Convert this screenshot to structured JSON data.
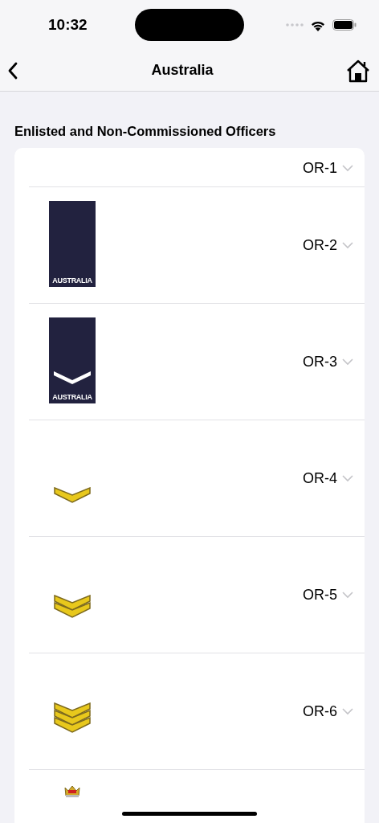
{
  "status_bar": {
    "time": "10:32"
  },
  "nav": {
    "title": "Australia"
  },
  "section": {
    "title": "Enlisted and Non-Commissioned Officers",
    "rows": [
      {
        "label": "OR-1",
        "expanded": false
      },
      {
        "label": "OR-2",
        "expanded": false,
        "insignia": {
          "kind": "plain-slide",
          "text": "AUSTRALIA"
        }
      },
      {
        "label": "OR-3",
        "expanded": false,
        "insignia": {
          "kind": "chevron-slide",
          "text": "AUSTRALIA"
        }
      },
      {
        "label": "OR-4",
        "expanded": false,
        "insignia": {
          "kind": "single-chevron"
        }
      },
      {
        "label": "OR-5",
        "expanded": false,
        "insignia": {
          "kind": "double-chevron"
        }
      },
      {
        "label": "OR-6",
        "expanded": false,
        "insignia": {
          "kind": "triple-chevron"
        }
      },
      {
        "insignia": {
          "kind": "crown"
        }
      }
    ]
  }
}
